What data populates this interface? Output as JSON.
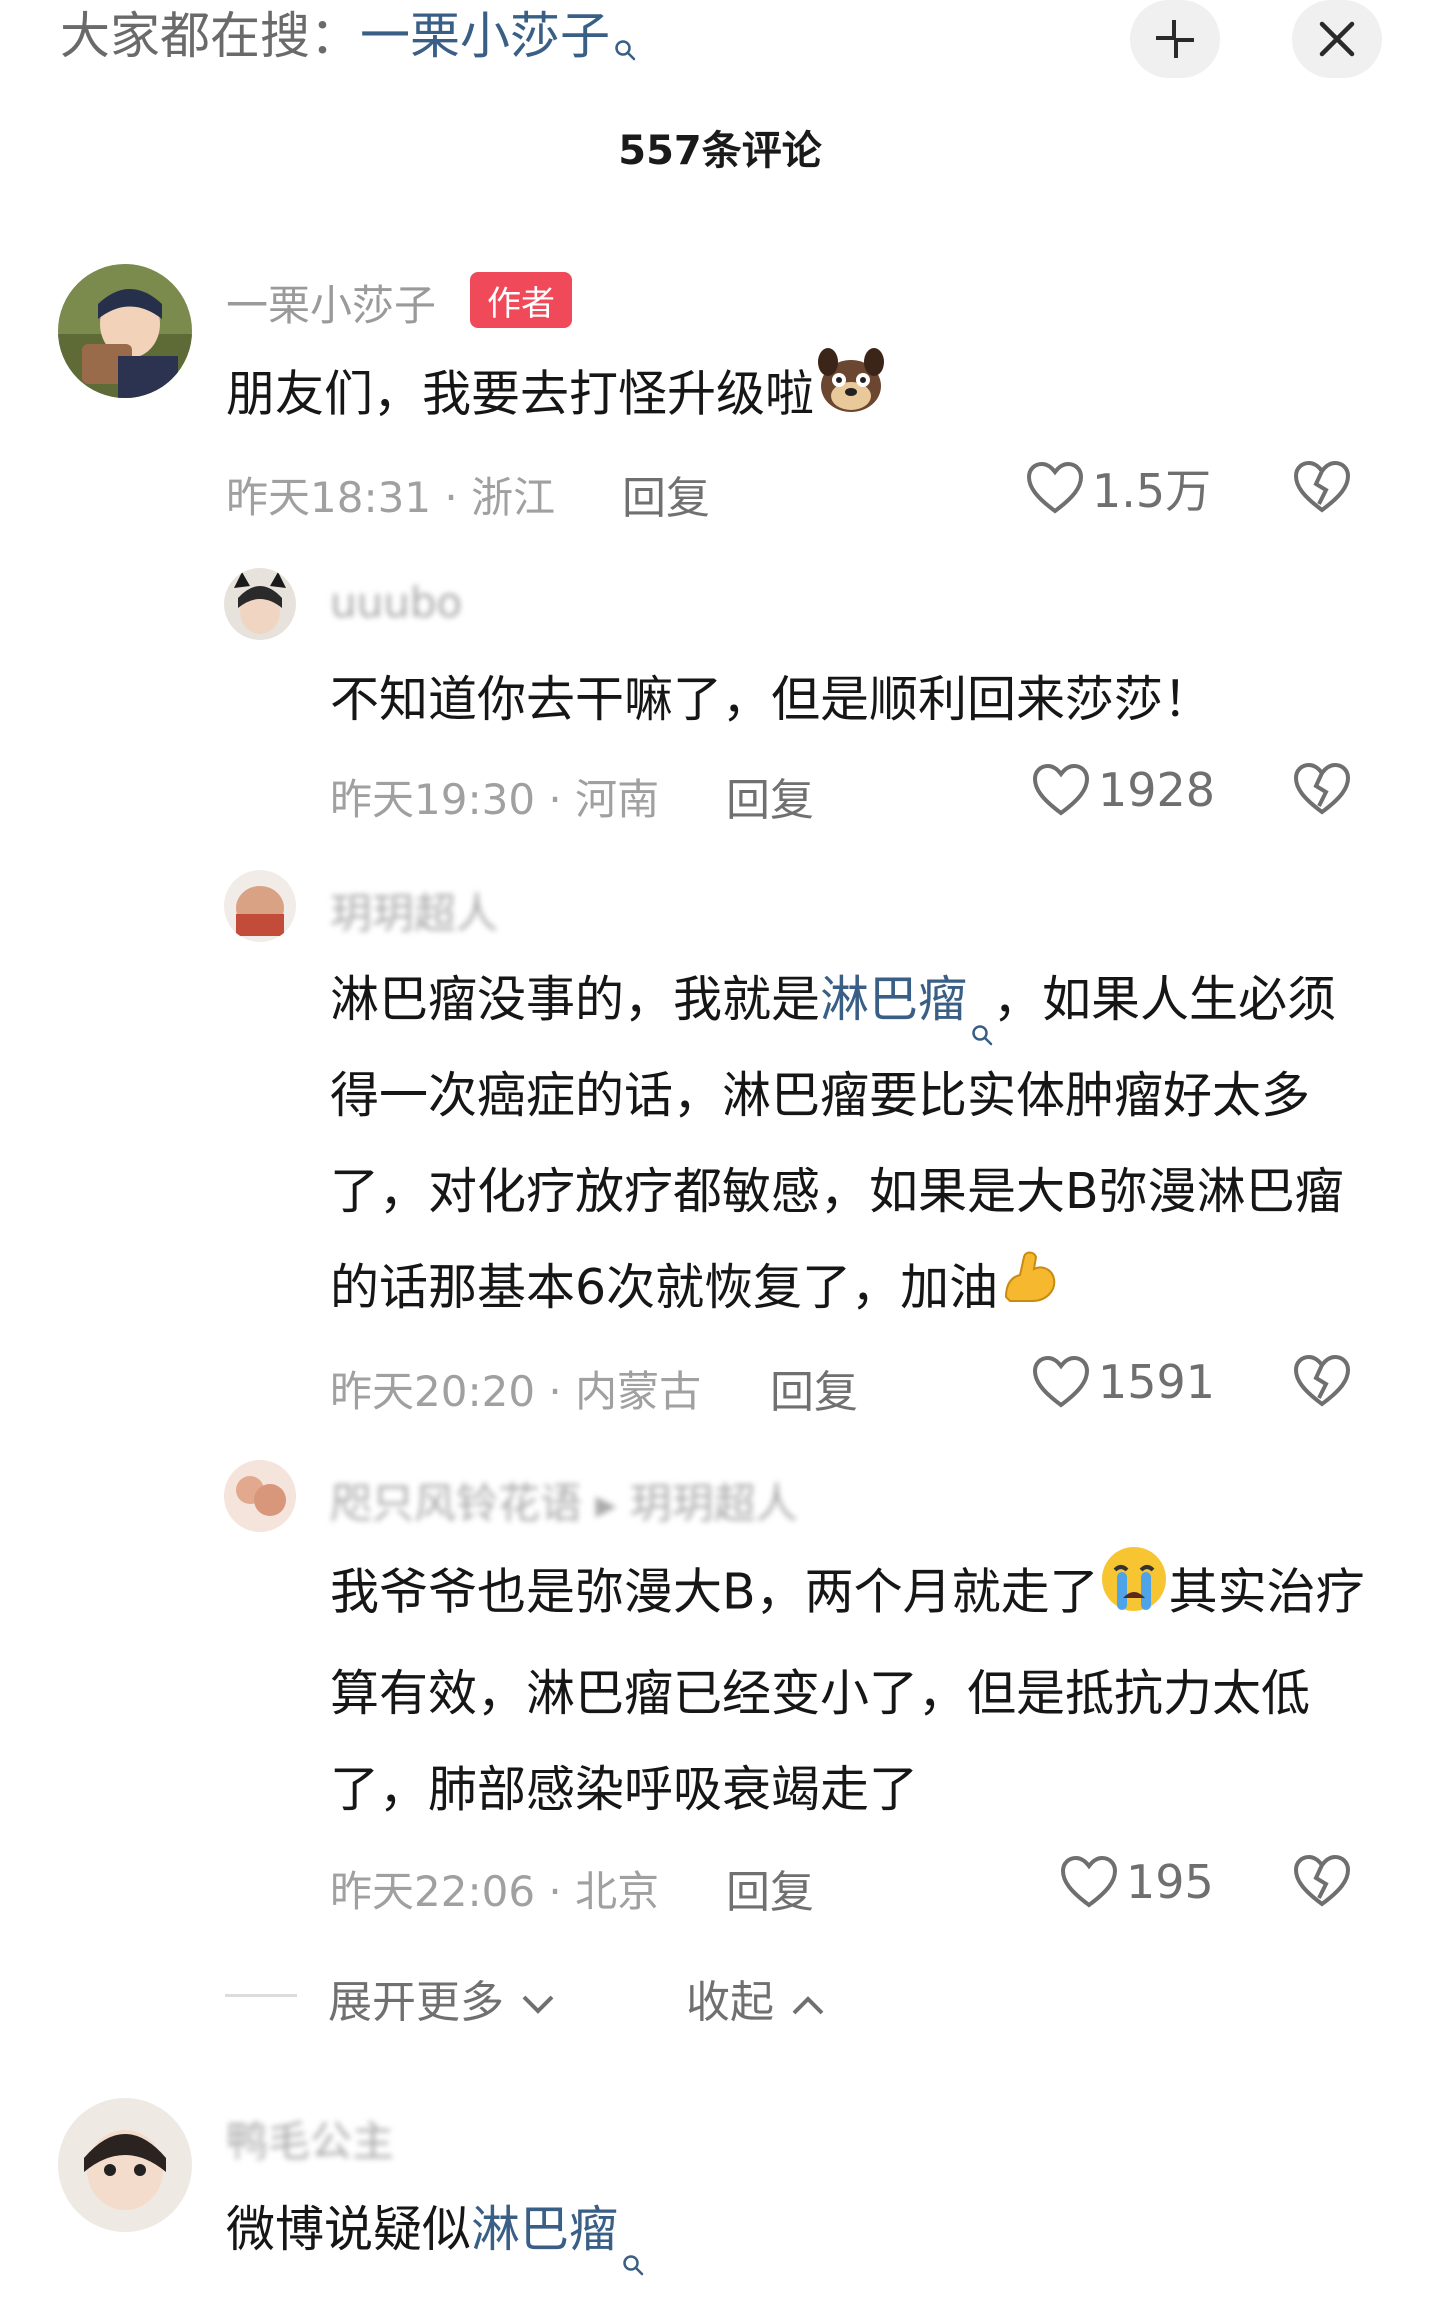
{
  "search_bar": {
    "prefix": "大家都在搜：",
    "term": "一栗小莎子"
  },
  "header": {
    "comment_count": "557条评论"
  },
  "comments": [
    {
      "username": "一栗小莎子",
      "badge": "作者",
      "text": "朋友们，我要去打怪升级啦",
      "emoji_icon": "dog-face-emoji",
      "meta": "昨天18:31 · 浙江",
      "reply_label": "回复",
      "likes": "1.5万"
    },
    {
      "username": "uuubo",
      "text": "不知道你去干嘛了，但是顺利回来莎莎！",
      "meta": "昨天19:30 · 河南",
      "reply_label": "回复",
      "likes": "1928"
    },
    {
      "username": "玥玥超人",
      "text_before_link": "淋巴瘤没事的，我就是",
      "link_text": "淋巴瘤",
      "text_after_link": "，如果人生必须得一次癌症的话，淋巴瘤要比实体肿瘤好太多了，对化疗放疗都敏感，如果是大B弥漫淋巴瘤的话那基本6次就恢复了，加油",
      "emoji_icon": "flexed-biceps-emoji",
      "meta": "昨天20:20 · 内蒙古",
      "reply_label": "回复",
      "likes": "1591"
    },
    {
      "username": "咫只风铃花语 ▸ 玥玥超人",
      "text_before_emoji": "我爷爷也是弥漫大B，两个月就走了",
      "emoji_icon": "crying-face-emoji",
      "text_after_emoji": "其实治疗算有效，淋巴瘤已经变小了，但是抵抗力太低了，肺部感染呼吸衰竭走了",
      "meta": "昨天22:06 · 北京",
      "reply_label": "回复",
      "likes": "195"
    },
    {
      "username": "鸭毛公主",
      "text_before_link": "微博说疑似",
      "link_text": "淋巴瘤"
    }
  ],
  "thread_controls": {
    "expand": "展开更多",
    "collapse": "收起"
  }
}
